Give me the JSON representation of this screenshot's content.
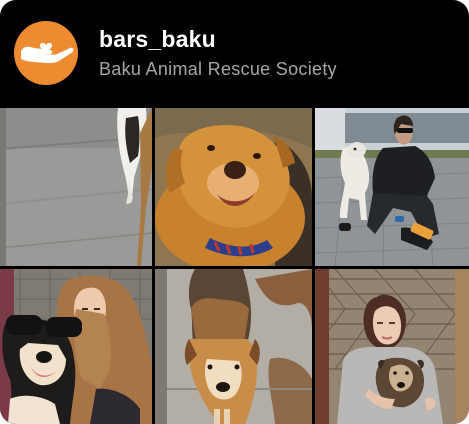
{
  "profile": {
    "username": "bars_baku",
    "display_name": "Baku Animal Rescue Society",
    "avatar_icon": "hand-with-heart-icon",
    "avatar_color": "#ee8a2f"
  },
  "grid": {
    "posts": [
      {
        "subject": "dog-on-pavement-photo"
      },
      {
        "subject": "golden-dog-portrait-photo"
      },
      {
        "subject": "woman-with-white-dog-photo"
      },
      {
        "subject": "woman-with-dog-selfie-photo"
      },
      {
        "subject": "dog-in-cage-photo"
      },
      {
        "subject": "woman-holding-puppy-photo"
      }
    ]
  }
}
